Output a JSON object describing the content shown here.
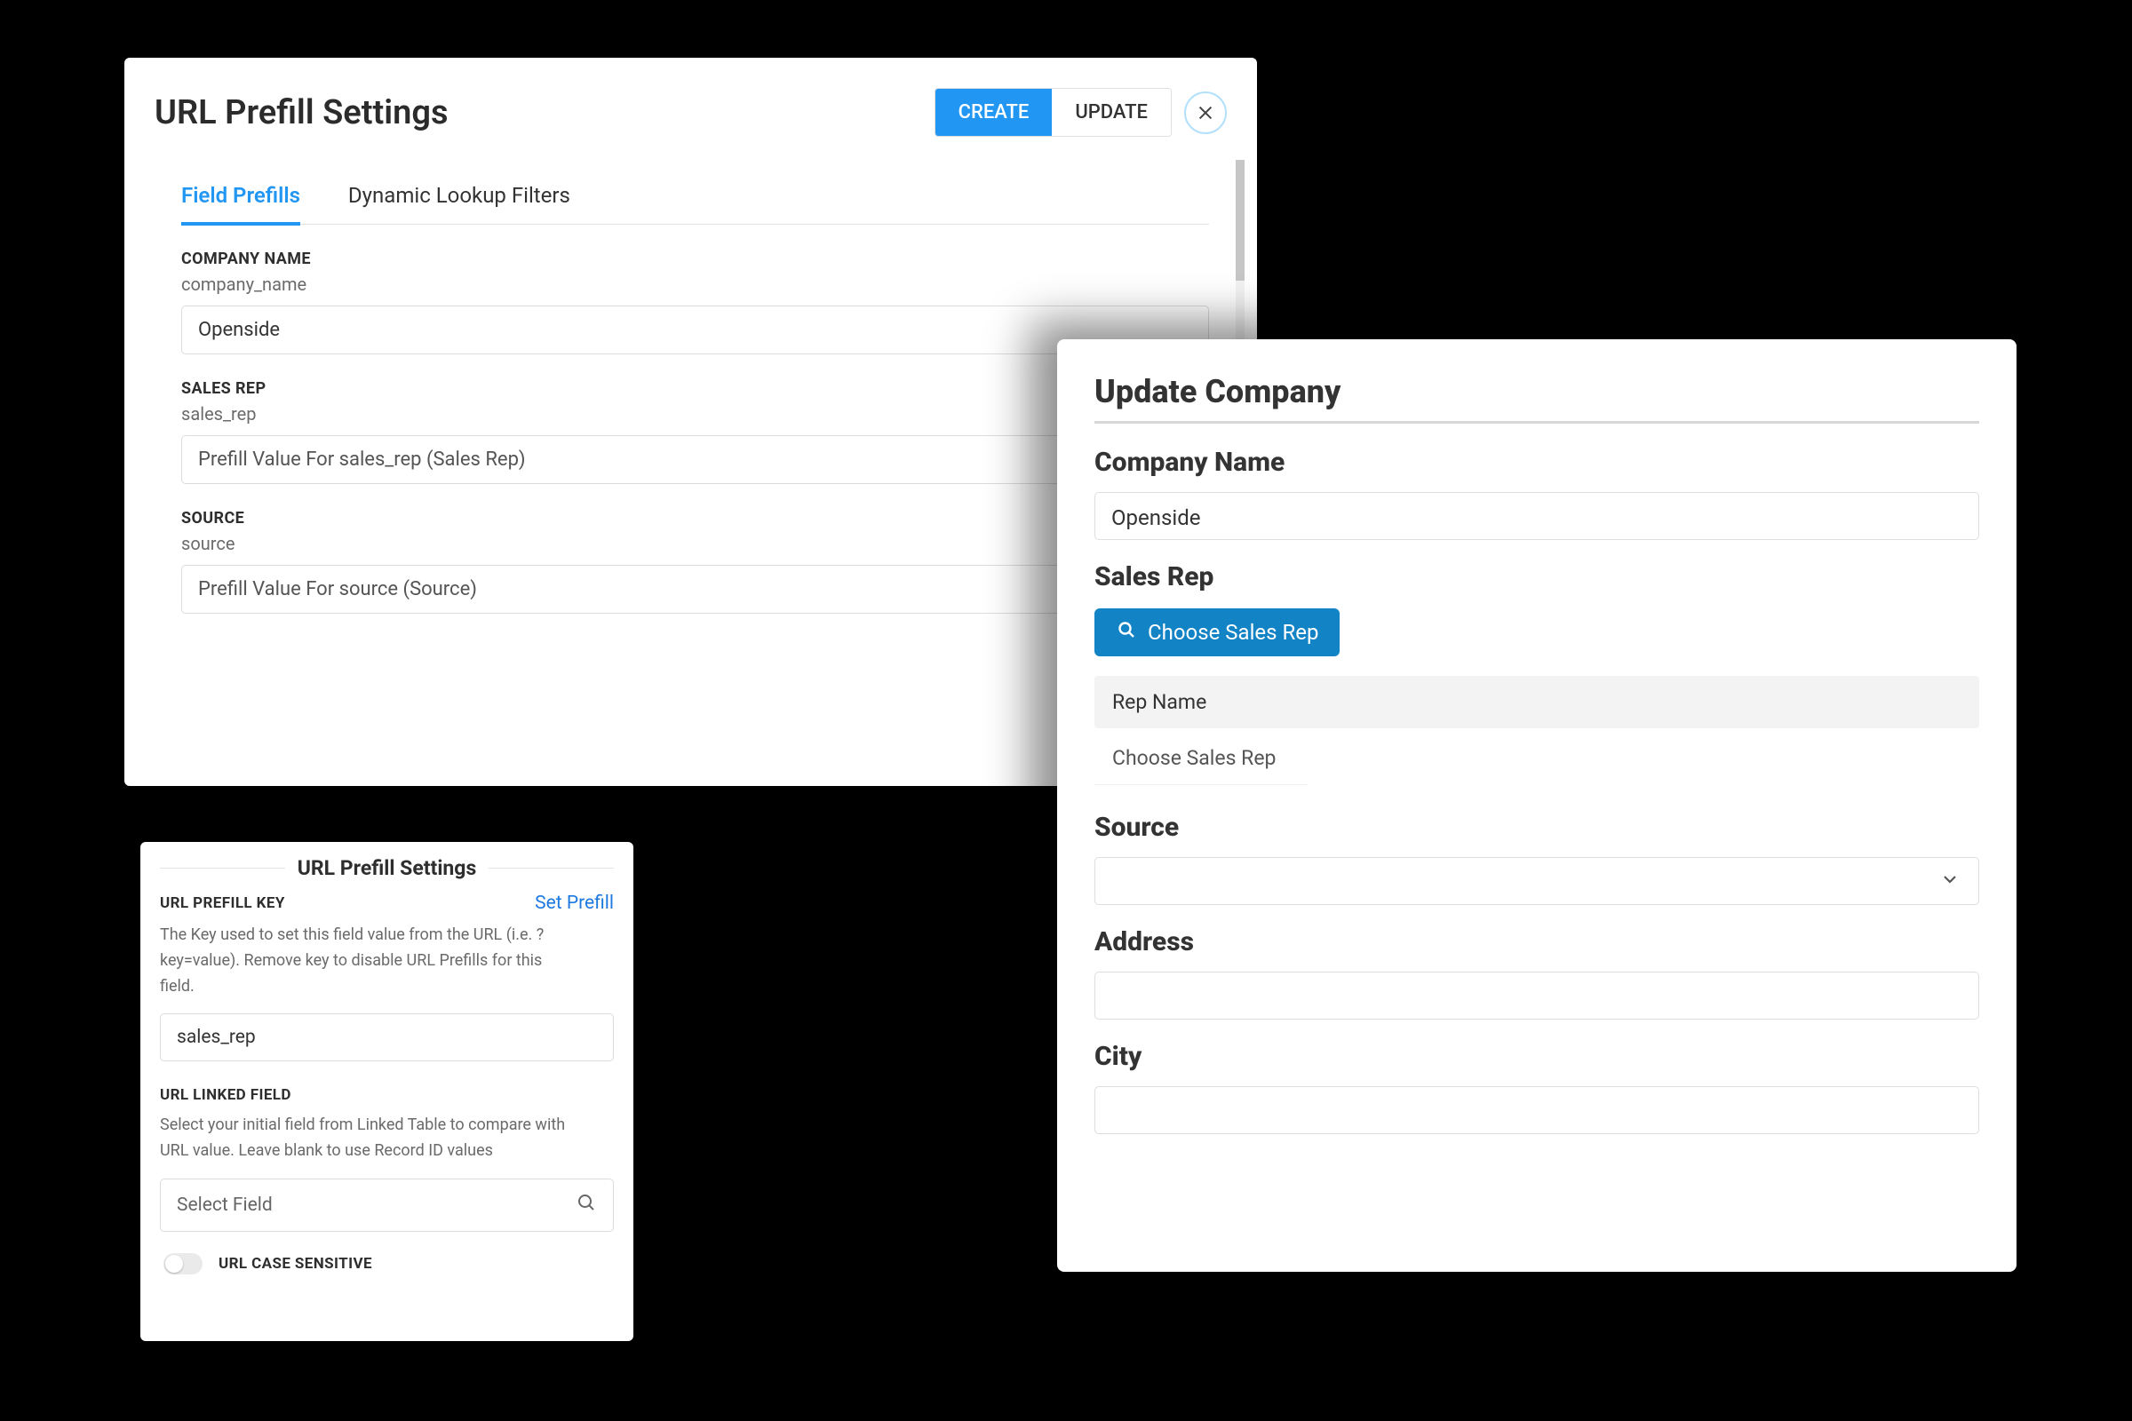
{
  "panel1": {
    "title": "URL Prefill Settings",
    "actions": {
      "create": "CREATE",
      "update": "UPDATE"
    },
    "tabs": {
      "field_prefills": "Field Prefills",
      "dynamic_filters": "Dynamic Lookup Filters"
    },
    "fields": [
      {
        "label": "COMPANY NAME",
        "key": "company_name",
        "value": "Openside"
      },
      {
        "label": "SALES REP",
        "key": "sales_rep",
        "value": "Prefill Value For sales_rep (Sales Rep)"
      },
      {
        "label": "SOURCE",
        "key": "source",
        "value": "Prefill Value For source (Source)"
      }
    ]
  },
  "panel2": {
    "title": "URL Prefill Settings",
    "key_section": {
      "label": "URL PREFILL KEY",
      "link": "Set Prefill",
      "help": "The Key used to set this field value from the URL (i.e. ?key=value). Remove key to disable URL Prefills for this field.",
      "value": "sales_rep"
    },
    "linked_section": {
      "label": "URL LINKED FIELD",
      "help": "Select your initial field from Linked Table to compare with URL value. Leave blank to use Record ID values",
      "placeholder": "Select Field"
    },
    "case_sensitive_label": "URL CASE SENSITIVE"
  },
  "panel3": {
    "title": "Update Company",
    "company_name": {
      "label": "Company Name",
      "value": "Openside"
    },
    "sales_rep": {
      "label": "Sales Rep",
      "button": "Choose Sales Rep",
      "list_header": "Rep Name",
      "list_item": "Choose Sales Rep"
    },
    "source": {
      "label": "Source"
    },
    "address": {
      "label": "Address"
    },
    "city": {
      "label": "City"
    }
  }
}
